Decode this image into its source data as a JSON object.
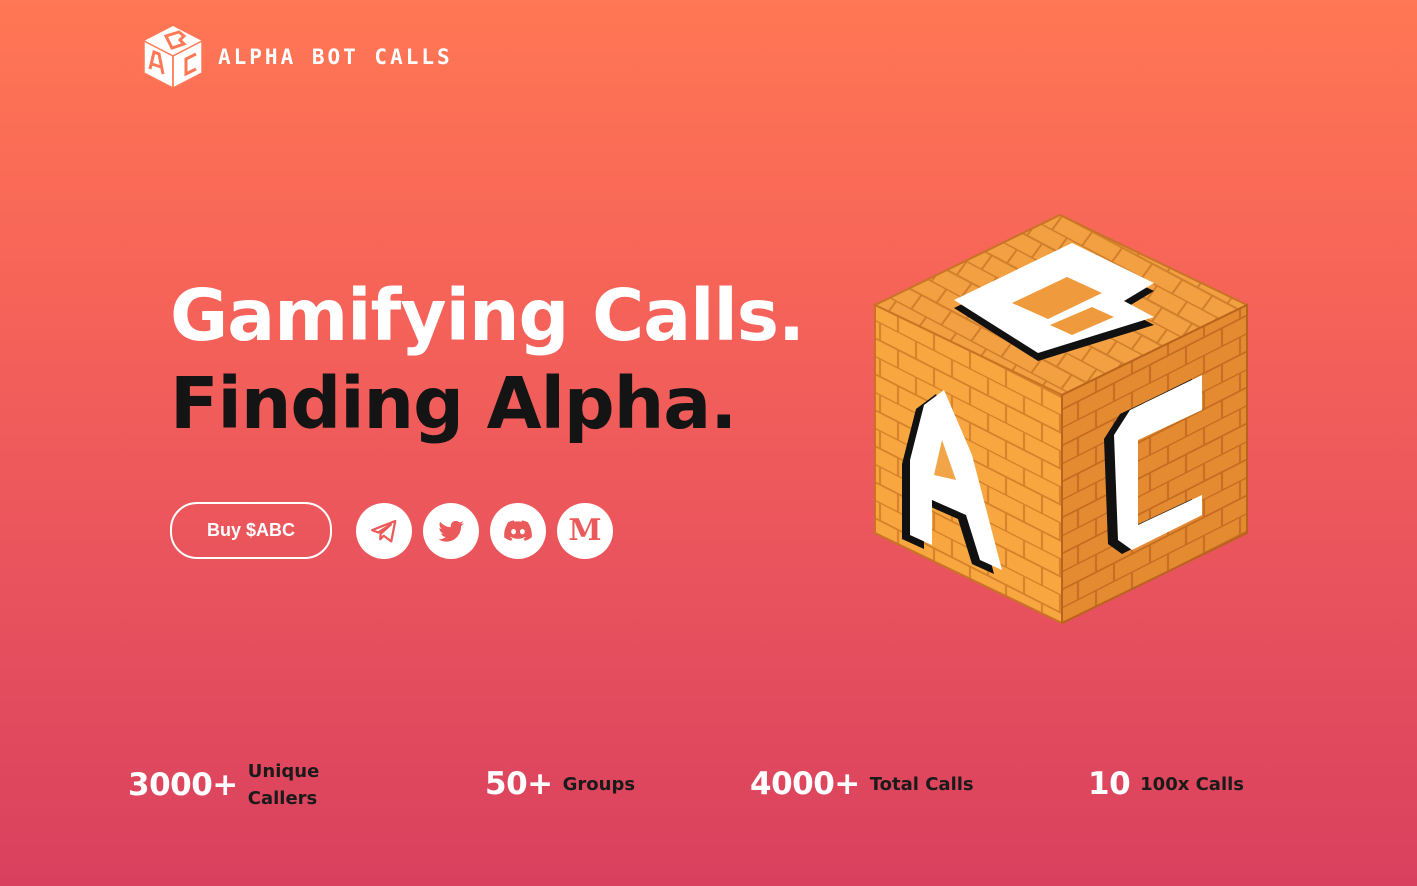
{
  "brand": {
    "name": "ALPHA BOT CALLS",
    "logo_icon": "abc-cube-logo-icon"
  },
  "hero": {
    "headline_line1": "Gamifying Calls.",
    "headline_line2": "Finding Alpha."
  },
  "actions": {
    "buy_label": "Buy $ABC",
    "socials": [
      {
        "name": "telegram",
        "icon": "telegram-icon"
      },
      {
        "name": "twitter",
        "icon": "twitter-icon"
      },
      {
        "name": "discord",
        "icon": "discord-icon"
      },
      {
        "name": "medium",
        "icon": "medium-icon",
        "glyph": "M"
      }
    ]
  },
  "illustration": {
    "icon": "abc-brick-cube-illustration",
    "letters": [
      "A",
      "B",
      "C"
    ]
  },
  "stats": [
    {
      "value": "3000+",
      "label": "Unique Callers"
    },
    {
      "value": "50+",
      "label": "Groups"
    },
    {
      "value": "4000+",
      "label": "Total Calls"
    },
    {
      "value": "10",
      "label": "100x Calls"
    }
  ],
  "colors": {
    "gradient_top": "#ff7754",
    "gradient_bottom": "#d9405e",
    "accent_dark": "#141414",
    "icon_color": "#ea5a5a",
    "cube_orange": "#f6a03d"
  }
}
